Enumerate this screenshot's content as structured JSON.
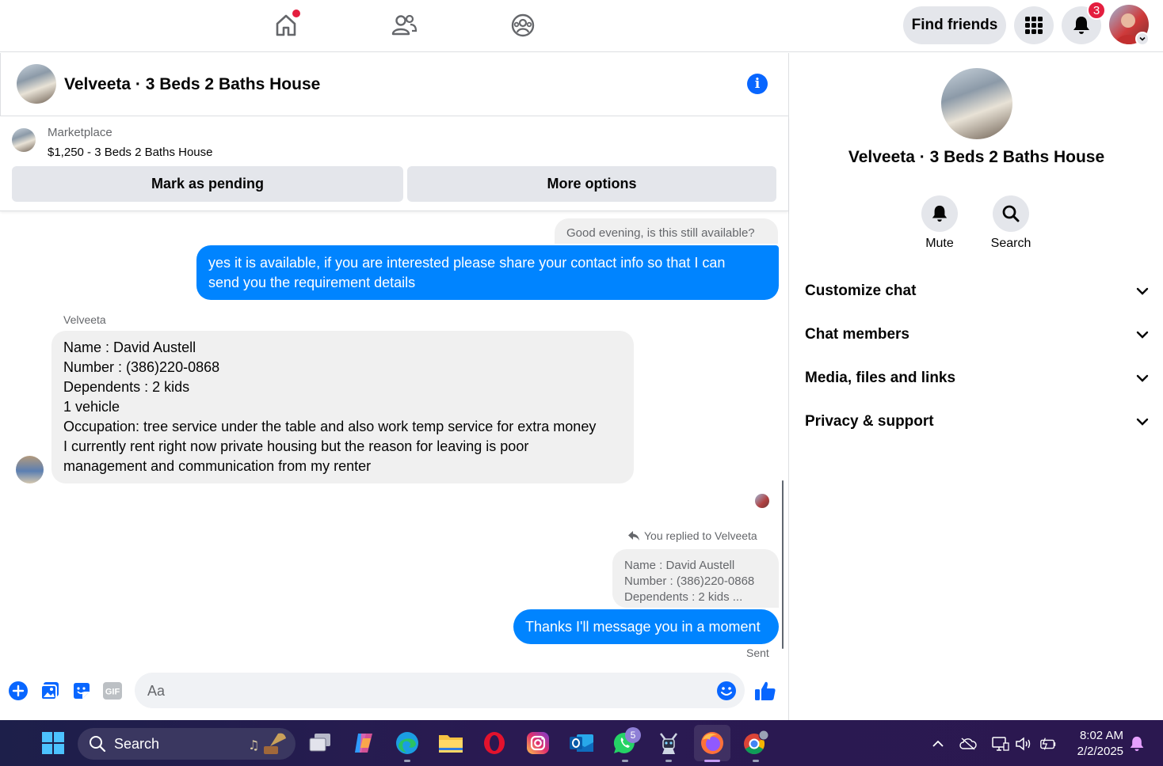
{
  "topbar": {
    "find_friends_label": "Find friends",
    "notification_count": "3"
  },
  "chat": {
    "title": "Velveeta · 3 Beds 2 Baths House",
    "marketplace_label": "Marketplace",
    "listing": "$1,250 - 3 Beds 2 Baths House",
    "mark_pending_label": "Mark as pending",
    "more_options_label": "More options",
    "messages": {
      "incoming_1": "Good evening, is this still available?",
      "outgoing_1_line1": "yes it is available, if you are interested please share your contact info so that I can",
      "outgoing_1_line2": "send you the requirement details",
      "sender_name": "Velveeta",
      "incoming_2_lines": [
        "Name : David Austell",
        "Number : (386)220-0868",
        "Dependents : 2 kids",
        "1 vehicle",
        "Occupation: tree service under the table and also work temp service for extra money",
        "I currently rent right now private housing but the reason for leaving is poor",
        "management and communication from my renter"
      ],
      "reply_label": "You replied to Velveeta",
      "reply_quote_lines": [
        "Name : David Austell",
        "Number : (386)220-0868",
        "Dependents : 2 kids ..."
      ],
      "outgoing_2": "Thanks I'll message you in a moment",
      "status": "Sent"
    },
    "composer_placeholder": "Aa"
  },
  "info_panel": {
    "title": "Velveeta · 3 Beds 2 Baths House",
    "mute_label": "Mute",
    "search_label": "Search",
    "sections": [
      "Customize chat",
      "Chat members",
      "Media, files and links",
      "Privacy & support"
    ]
  },
  "taskbar": {
    "search_label": "Search",
    "whatsapp_badge": "5",
    "time": "8:02 AM",
    "date": "2/2/2025"
  },
  "colors": {
    "accent": "#0084ff",
    "brand": "#0866ff",
    "badge": "#e41e3f"
  }
}
